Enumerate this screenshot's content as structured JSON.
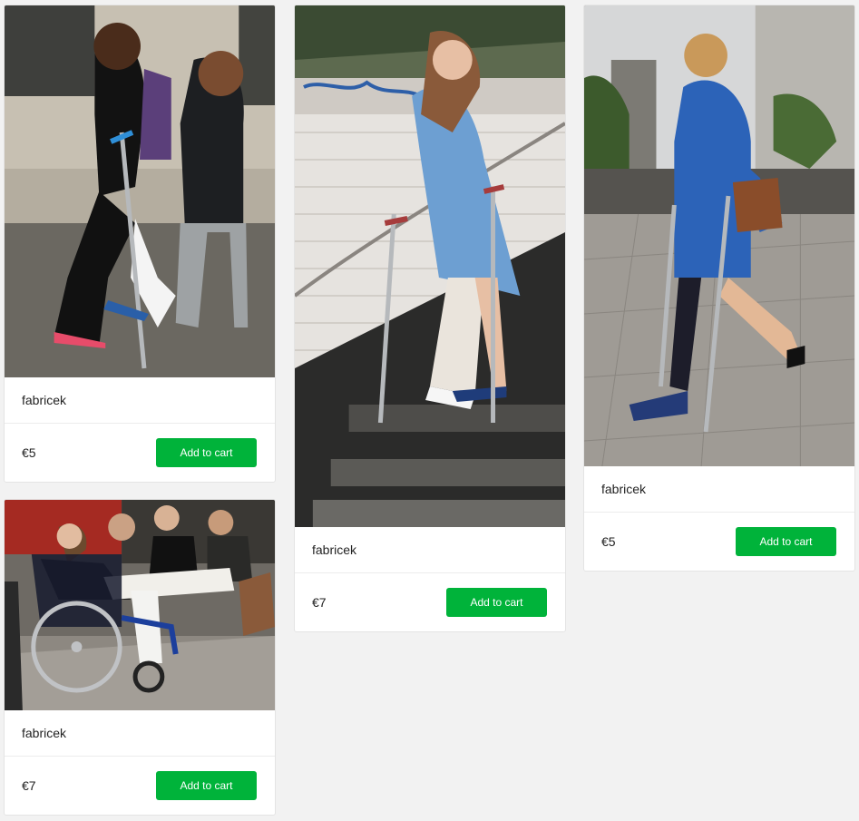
{
  "theme": {
    "background": "#f2f2f2",
    "button_color": "#00b33a"
  },
  "products": [
    {
      "author": "fabricek",
      "price": "€5",
      "button_label": "Add to cart",
      "image": "photo: teenage girl on a forearm crutch with a white leg cast walking past other students"
    },
    {
      "author": "fabricek",
      "price": "€7",
      "button_label": "Add to cart",
      "image": "photo: young woman in a light blue dress with a white leg cast walking down subway stairs on crutches"
    },
    {
      "author": "fabricek",
      "price": "€5",
      "button_label": "Add to cart",
      "image": "photo: woman in a blue dress with a walking boot using crutches on a city sidewalk"
    },
    {
      "author": "fabricek",
      "price": "€7",
      "button_label": "Add to cart",
      "image": "photo: young woman in a wheelchair with a white leg cast outside a cafe"
    }
  ]
}
